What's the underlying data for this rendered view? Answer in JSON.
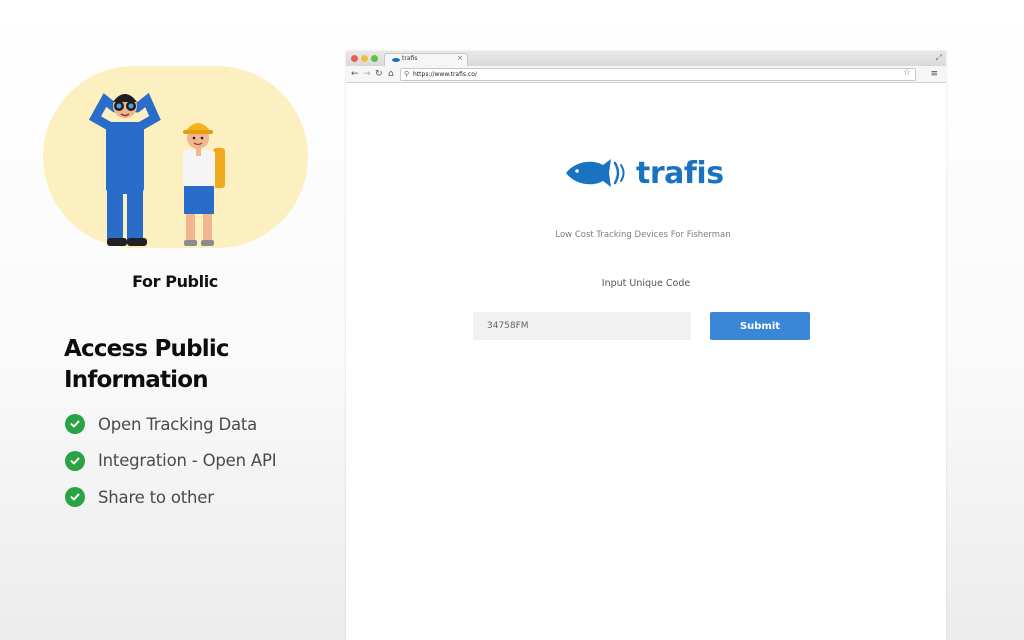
{
  "left": {
    "illustration_caption": "For Public",
    "heading": "Access Public Information",
    "features": [
      {
        "label": "Open Tracking Data",
        "icon": "check-circle-icon"
      },
      {
        "label": "Integration - Open API",
        "icon": "check-circle-icon"
      },
      {
        "label": "Share to other",
        "icon": "check-circle-icon"
      }
    ],
    "accent_color": "#2aa345"
  },
  "browser": {
    "tab_title": "trafis",
    "tab_close": "×",
    "url": "https://www.trafis.co/"
  },
  "page": {
    "brand_name": "trafis",
    "tagline": "Low Cost Tracking Devices For Fisherman",
    "code_label": "Input Unique Code",
    "code_value": "34758FM",
    "submit_label": "Submit",
    "brand_color": "#1a73c0",
    "button_color": "#3a87d8"
  }
}
